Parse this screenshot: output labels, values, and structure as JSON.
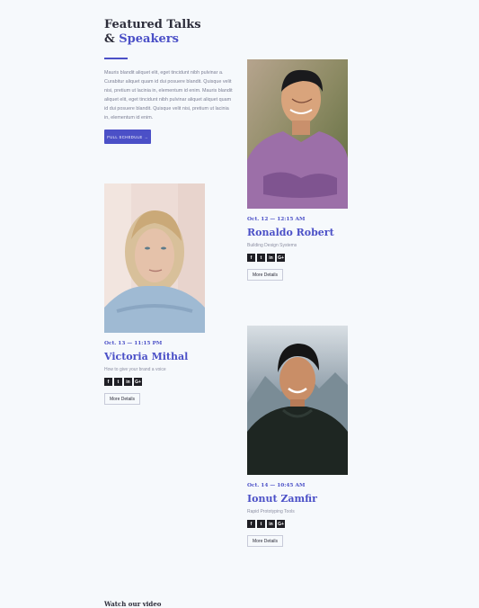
{
  "section": {
    "title_line1": "Featured Talks",
    "title_line2_prefix": "&",
    "title_line2_accent": "Speakers",
    "intro": "Mauris blandit aliquet elit, eget tincidunt nibh pulvinar a. Curabitur aliquet quam id dui posuere blandit. Quisque velit nisi, pretium ut lacinia in, elementum id enim. Mauris blandit aliquet elit, eget tincidunt nibh pulvinar aliquet aliquet quam id dui posuere blandit. Quisque velit nisi, pretium ut lacinia in, elementum id enim.",
    "button_label": "FULL SCHEDULE →"
  },
  "speakers": [
    {
      "date": "Oct. 12 — 12:15 AM",
      "name": "Ronaldo Robert",
      "topic": "Building Design Systems",
      "details_label": "More Details"
    },
    {
      "date": "Oct. 13 — 11:15 PM",
      "name": "Victoria Mithal",
      "topic": "How to give your brand a voice",
      "details_label": "More Details"
    },
    {
      "date": "Oct. 14 — 10:45 AM",
      "name": "Ionut Zamfir",
      "topic": "Rapid Prototyping Tools",
      "details_label": "More Details"
    }
  ],
  "social_icons": [
    "facebook-icon",
    "twitter-icon",
    "linkedin-icon",
    "google-plus-icon"
  ],
  "video_heading": "Watch our video",
  "colors": {
    "accent": "#4b50c7",
    "background": "#f6f9fc",
    "text": "#2d2d3a"
  }
}
